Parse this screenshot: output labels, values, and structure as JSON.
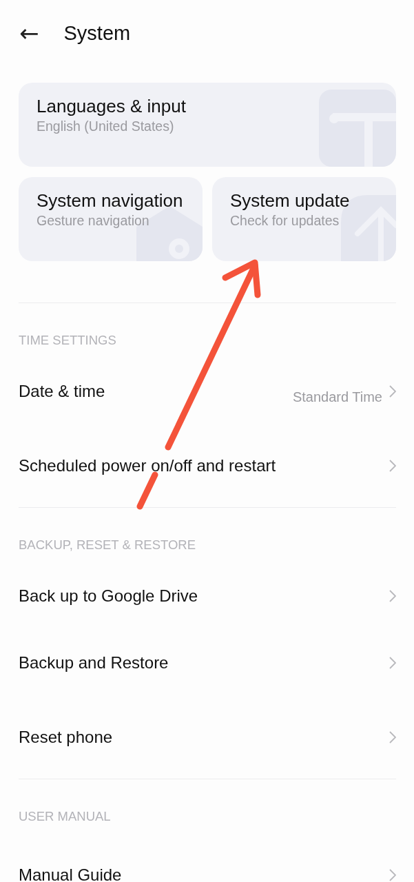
{
  "header": {
    "back": "←",
    "title": "System"
  },
  "cards": [
    {
      "kind": "wide",
      "title": "Languages & input",
      "subtitle": "English (United States)"
    },
    {
      "kind": "half",
      "title": "System navigation",
      "subtitle": "Gesture navigation"
    },
    {
      "kind": "half",
      "title": "System update",
      "subtitle": "Check for updates"
    }
  ],
  "sections": [
    {
      "heading": "TIME SETTINGS",
      "rows": [
        {
          "label": "Date & time",
          "value": "Standard Time"
        },
        {
          "label": "Scheduled power on/off and restart"
        }
      ]
    },
    {
      "heading": "BACKUP, RESET & RESTORE",
      "rows": [
        {
          "label": "Back up to Google Drive"
        },
        {
          "label": "Backup and Restore"
        },
        {
          "label": "Reset phone"
        }
      ]
    },
    {
      "heading": "USER MANUAL",
      "rows": [
        {
          "label": "Manual Guide"
        }
      ]
    }
  ]
}
